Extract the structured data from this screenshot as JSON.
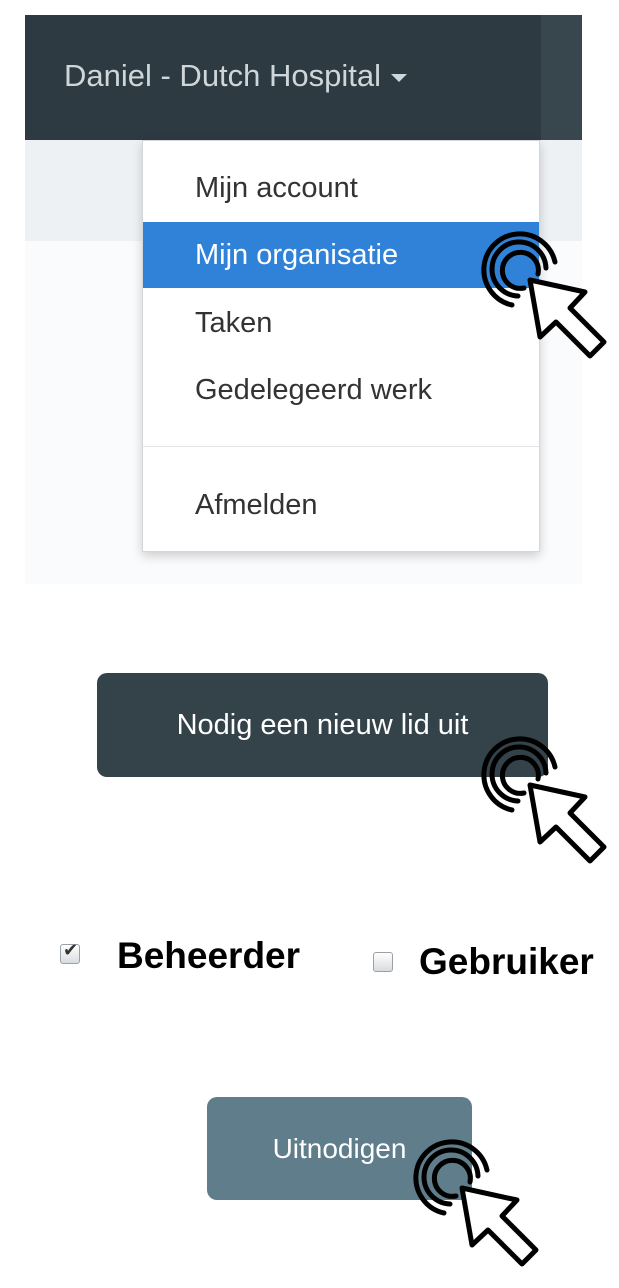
{
  "navbar": {
    "user_menu": "Daniel - Dutch Hospital"
  },
  "dropdown": {
    "items": [
      {
        "label": "Mijn account"
      },
      {
        "label": "Mijn organisatie"
      },
      {
        "label": "Taken"
      },
      {
        "label": "Gedelegeerd werk"
      },
      {
        "label": "Afmelden"
      }
    ],
    "active_index": 1
  },
  "invite_button": {
    "label": "Nodig een nieuw lid uit"
  },
  "roles": [
    {
      "label": "Beheerder",
      "checked": true
    },
    {
      "label": "Gebruiker",
      "checked": false
    }
  ],
  "submit_button": {
    "label": "Uitnodigen"
  },
  "colors": {
    "navbar": "#2e3a41",
    "active_item": "#2f82d8",
    "primary_button": "#344249",
    "submit_button": "#607d8b"
  }
}
